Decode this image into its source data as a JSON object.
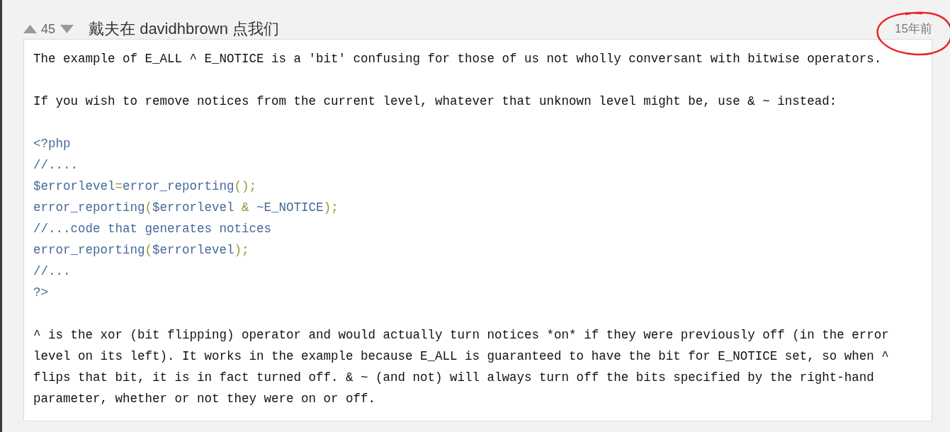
{
  "note": {
    "votes": {
      "count": "45"
    },
    "author": "戴夫在 davidhbrown 点我们",
    "date": {
      "text": "15年前",
      "circled": true
    },
    "body": [
      {
        "kind": "text",
        "text": "The example of E_ALL ^ E_NOTICE is a 'bit' confusing for those of us not wholly conversant with bitwise operators."
      },
      {
        "kind": "text",
        "text": "If you wish to remove notices from the current level, whatever that unknown level might be, use & ~ instead:"
      },
      {
        "kind": "code",
        "lines": [
          {
            "tokens": [
              {
                "text": "<?php",
                "kind": "default"
              }
            ]
          },
          {
            "tokens": [
              {
                "text": "//....",
                "kind": "default"
              }
            ]
          },
          {
            "tokens": [
              {
                "text": "$errorlevel",
                "kind": "default"
              },
              {
                "text": "=",
                "kind": "keyword"
              },
              {
                "text": "error_reporting",
                "kind": "default"
              },
              {
                "text": "();",
                "kind": "keyword"
              }
            ]
          },
          {
            "tokens": [
              {
                "text": "error_reporting",
                "kind": "default"
              },
              {
                "text": "(",
                "kind": "keyword"
              },
              {
                "text": "$errorlevel ",
                "kind": "default"
              },
              {
                "text": "&",
                "kind": "keyword"
              },
              {
                "text": " ~E_NOTICE",
                "kind": "default"
              },
              {
                "text": ");",
                "kind": "keyword"
              }
            ]
          },
          {
            "tokens": [
              {
                "text": "//...code that generates notices",
                "kind": "default"
              }
            ]
          },
          {
            "tokens": [
              {
                "text": "error_reporting",
                "kind": "default"
              },
              {
                "text": "(",
                "kind": "keyword"
              },
              {
                "text": "$errorlevel",
                "kind": "default"
              },
              {
                "text": ");",
                "kind": "keyword"
              }
            ]
          },
          {
            "tokens": [
              {
                "text": "//...",
                "kind": "default"
              }
            ]
          },
          {
            "tokens": [
              {
                "text": "?>",
                "kind": "default"
              }
            ]
          }
        ]
      },
      {
        "kind": "text",
        "text": "^ is the xor (bit flipping) operator and would actually turn notices *on* if they were previously off (in the error level on its left). It works in the example because E_ALL is guaranteed to have the bit for E_NOTICE set, so when ^ flips that bit, it is in fact turned off. & ~ (and not) will always turn off the bits specified by the right-hand parameter, whether or not they were on or off."
      }
    ]
  }
}
